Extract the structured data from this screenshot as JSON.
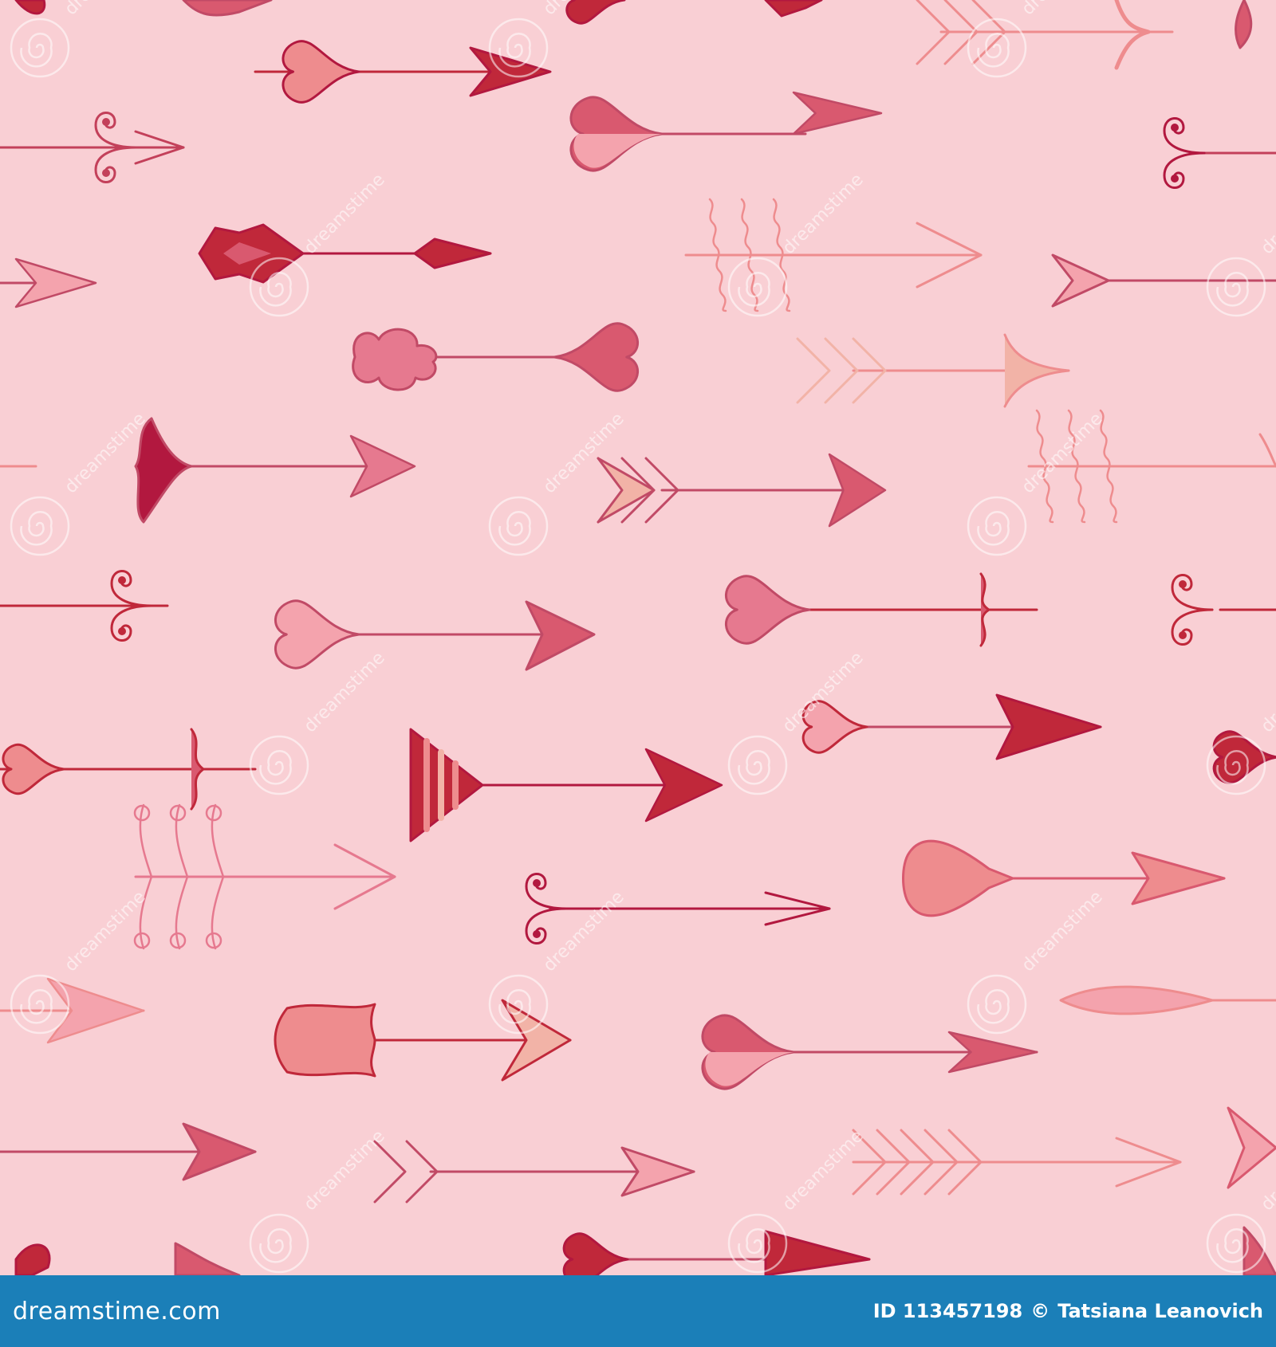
{
  "image": {
    "description_free": true,
    "background_color": "#f9cfd4",
    "palette": {
      "red": "#c0283a",
      "crimson": "#b2183f",
      "pink": "#e6798f",
      "rose": "#d9596f",
      "salmon": "#ee8c8e",
      "light": "#f4a3ad",
      "peach": "#f2b3a7",
      "wine": "#c14a66",
      "line": "#c3405a"
    },
    "watermark": {
      "text": "dreamstime"
    }
  },
  "footer": {
    "brand": "dreamstime.com",
    "id_label": "ID 113457198",
    "copyright_symbol": "©",
    "author": "Tatsiana Leanovich",
    "background": "#1b7fb8"
  }
}
